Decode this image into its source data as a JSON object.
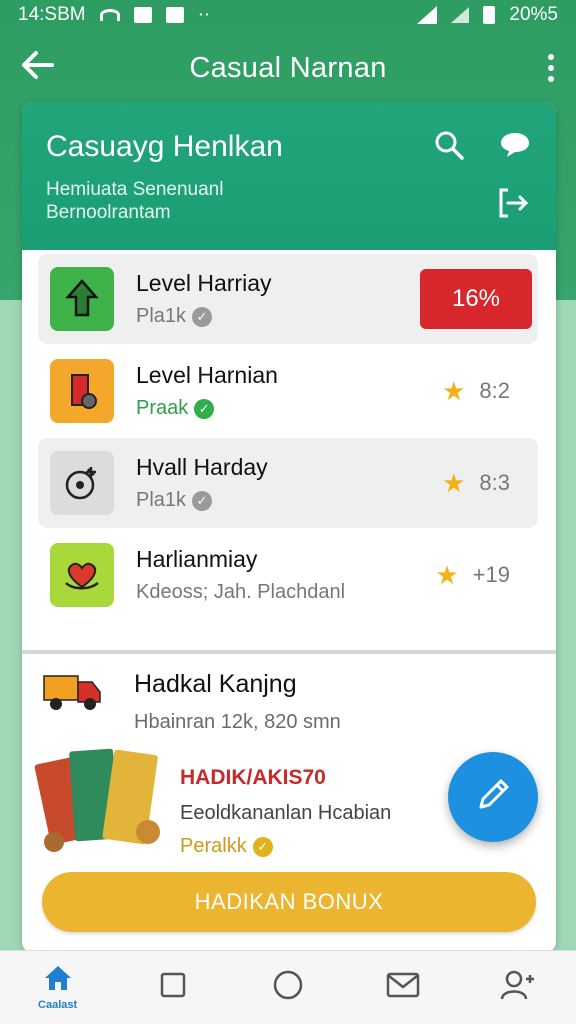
{
  "status_bar": {
    "time": "14:SBM",
    "dots": "··",
    "battery": "20%5"
  },
  "app_bar": {
    "title": "Casual Narnan"
  },
  "card_header": {
    "title": "Casuayg Henlkan",
    "subtitle_line1": "Hemiuata Senenuanl",
    "subtitle_line2": "Bernoolrantam"
  },
  "list": [
    {
      "title": "Level Harriay",
      "sub": "Pla1k",
      "badge": "16%"
    },
    {
      "title": "Level Harnian",
      "sub": "Praak",
      "rating": "8:2"
    },
    {
      "title": "Hvall Harday",
      "sub": "Pla1k",
      "rating": "8:3"
    },
    {
      "title": "Harlianmiay",
      "sub": "Kdeoss; Jah. Plachdanl",
      "rating": "+19"
    }
  ],
  "promo": {
    "title": "Hadkal Kanjng",
    "sub": "Hbainran 12k, 820 smn"
  },
  "bonus": {
    "title": "HADIK/AKIS70",
    "desc": "Eeoldkananlan Hcabian",
    "tag": "Peralkk",
    "button": "HADIKAN BONUX"
  },
  "bottom_nav": {
    "home_label": "Caalast"
  },
  "colors": {
    "primary": "#2f9e64",
    "header": "#1fa276",
    "danger": "#d8262d",
    "accent_gold": "#ebb530",
    "fab": "#1e90e0"
  }
}
